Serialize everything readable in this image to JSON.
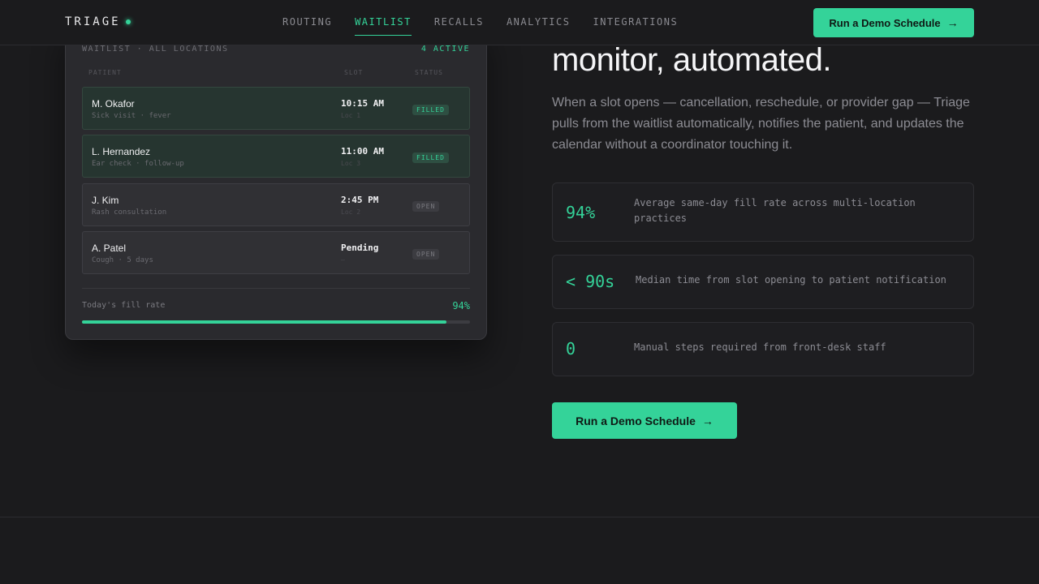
{
  "nav": {
    "brand": "TRIAGE",
    "links": [
      "ROUTING",
      "WAITLIST",
      "RECALLS",
      "ANALYTICS",
      "INTEGRATIONS"
    ],
    "active": "WAITLIST",
    "cta_label": "Run a Demo Schedule"
  },
  "card": {
    "title": "WAITLIST · ALL LOCATIONS",
    "count": "4 ACTIVE",
    "columns": {
      "patient": "PATIENT",
      "slot": "SLOT",
      "status": "STATUS"
    },
    "rows": [
      {
        "name": "M. Okafor",
        "reason": "Sick visit · fever",
        "time": "10:15 AM",
        "loc": "Loc 1",
        "status": "FILLED"
      },
      {
        "name": "L. Hernandez",
        "reason": "Ear check · follow-up",
        "time": "11:00 AM",
        "loc": "Loc 3",
        "status": "FILLED"
      },
      {
        "name": "J. Kim",
        "reason": "Rash consultation",
        "time": "2:45 PM",
        "loc": "Loc 2",
        "status": "OPEN"
      },
      {
        "name": "A. Patel",
        "reason": "Cough · 5 days",
        "time": "Pending",
        "loc": "—",
        "status": "OPEN"
      }
    ],
    "fill_label": "Today's fill rate",
    "fill_value": "94%",
    "fill_fraction": 0.94
  },
  "hero": {
    "headline": "monitor, automated.",
    "lede": "When a slot opens — cancellation, reschedule, or provider gap — Triage pulls from the waitlist automatically, notifies the patient, and updates the calendar without a coordinator touching it."
  },
  "stats": [
    {
      "value": "94%",
      "desc": "Average same-day fill rate across multi-location practices"
    },
    {
      "value": "< 90s",
      "desc": "Median time from slot opening to patient notification"
    },
    {
      "value": "0",
      "desc": "Manual steps required from front-desk staff"
    }
  ],
  "cta": {
    "label": "Run a Demo Schedule"
  },
  "colors": {
    "accent": "#34d399",
    "background": "#1b1b1d",
    "card": "#2a2a2e"
  }
}
